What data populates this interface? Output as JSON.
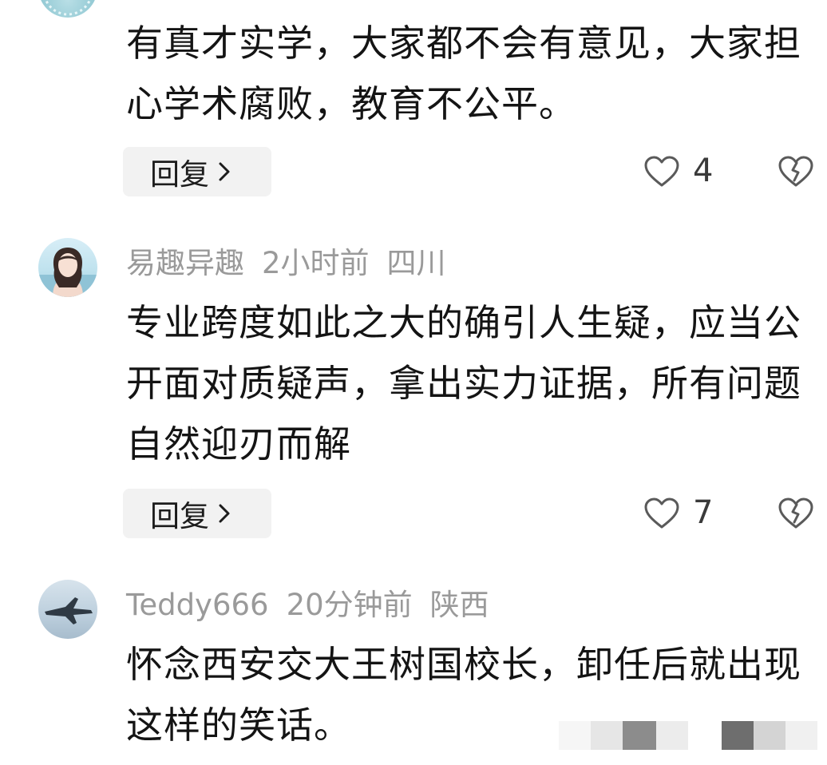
{
  "comments": [
    {
      "avatar": "teal-avatar",
      "text": "有真才实学，大家都不会有意见，大家担心学术腐败，教育不公平。",
      "reply_label": "回复",
      "likes": "4"
    },
    {
      "avatar": "girl-portrait-avatar",
      "username": "易趣异趣",
      "time": "2小时前",
      "location": "四川",
      "text": "专业跨度如此之大的确引人生疑，应当公开面对质疑声，拿出实力证据，所有问题自然迎刃而解",
      "reply_label": "回复",
      "likes": "7"
    },
    {
      "avatar": "fighter-jet-avatar",
      "username": "Teddy666",
      "time": "20分钟前",
      "location": "陕西",
      "text": "怀念西安交大王树国校长，卸任后就出现这样的笑话。"
    }
  ],
  "icons": {
    "like": "heart-outline-icon",
    "dislike": "broken-heart-icon",
    "reply_chevron": "chevron-right-icon"
  },
  "colors": {
    "meta_text": "#9a9a9a",
    "reply_bg": "#f2f2f2"
  }
}
